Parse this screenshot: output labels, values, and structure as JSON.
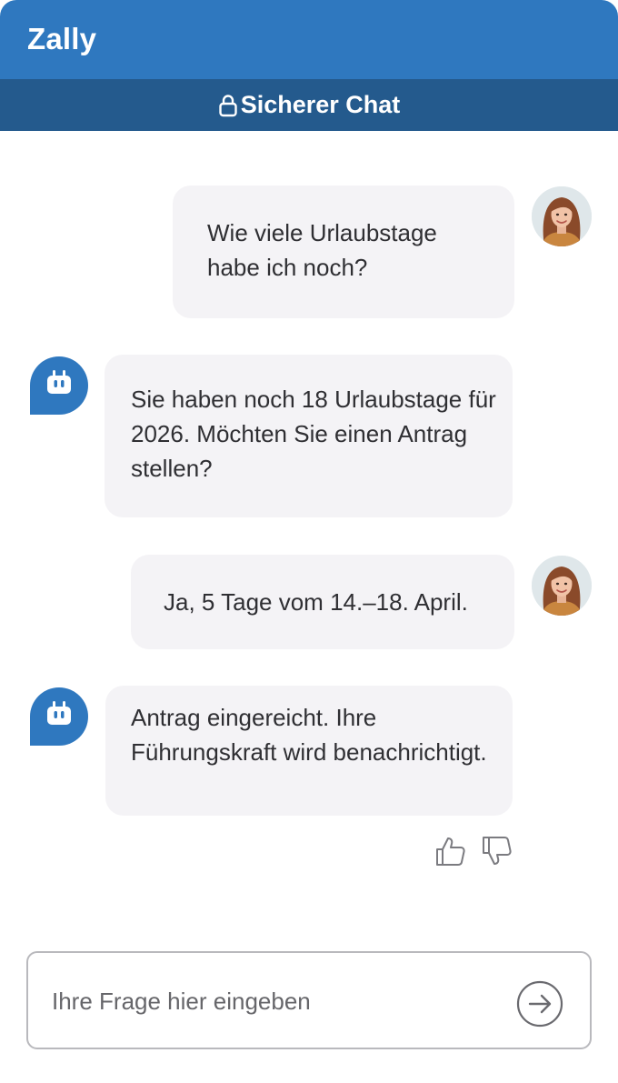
{
  "app": {
    "title": "Zally"
  },
  "banner": {
    "icon": "lock-icon",
    "label": "Sicherer Chat"
  },
  "messages": [
    {
      "sender": "user",
      "avatar": "user-avatar",
      "text": "Wie viele Urlaubstage habe ich noch?"
    },
    {
      "sender": "bot",
      "avatar": "bot-icon",
      "text": "Sie haben noch 18 Urlaubstage für 2026. Möchten Sie einen Antrag stellen?"
    },
    {
      "sender": "user",
      "avatar": "user-avatar",
      "text": "Ja, 5 Tage vom 14.–18. April."
    },
    {
      "sender": "bot",
      "avatar": "bot-icon",
      "text": "Antrag eingereicht. Ihre Führungskraft wird benachrichtigt."
    }
  ],
  "feedback": {
    "like_icon": "thumbs-up-icon",
    "dislike_icon": "thumbs-down-icon"
  },
  "composer": {
    "placeholder": "Ihre Frage hier eingeben",
    "value": "",
    "send_icon": "arrow-right-circle-icon"
  },
  "colors": {
    "header": "#2f78bf",
    "subheader": "#245a8d",
    "bubble": "#f4f3f6",
    "bot": "#2f78bf"
  }
}
